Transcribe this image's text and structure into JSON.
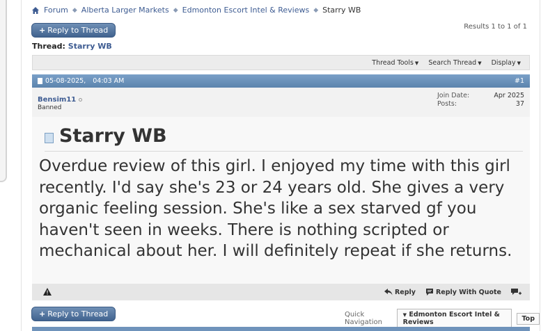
{
  "breadcrumb": {
    "items": [
      "Forum",
      "Alberta Larger Markets",
      "Edmonton Escort Intel & Reviews"
    ],
    "current": "Starry WB"
  },
  "reply_button": "Reply to Thread",
  "results": "Results 1 to 1 of 1",
  "thread": {
    "label": "Thread:",
    "title": "Starry WB"
  },
  "toolbar": [
    "Thread Tools",
    "Search Thread",
    "Display"
  ],
  "post": {
    "date": "05-08-2025,",
    "time": "04:03 AM",
    "number": "#1",
    "username": "Bensim11",
    "user_title": "Banned",
    "join_date_label": "Join Date:",
    "join_date": "Apr 2025",
    "posts_label": "Posts:",
    "posts": "37",
    "title": "Starry WB",
    "message": "Overdue review of this girl. I enjoyed my time with this girl recently. I'd say she's 23 or 24 years old. She gives a very organic feeling session. She's like a sex starved gf you haven't seen in weeks. There is nothing scripted or mechanical about her. I will definitely repeat if she returns."
  },
  "post_actions": {
    "reply": "Reply",
    "reply_quote": "Reply With Quote"
  },
  "quick_nav": {
    "label": "Quick Navigation",
    "selected": "Edmonton Escort Intel & Reviews",
    "top": "Top"
  },
  "colors": {
    "header_blue": "#5c84ad",
    "link": "#3e5c92"
  }
}
